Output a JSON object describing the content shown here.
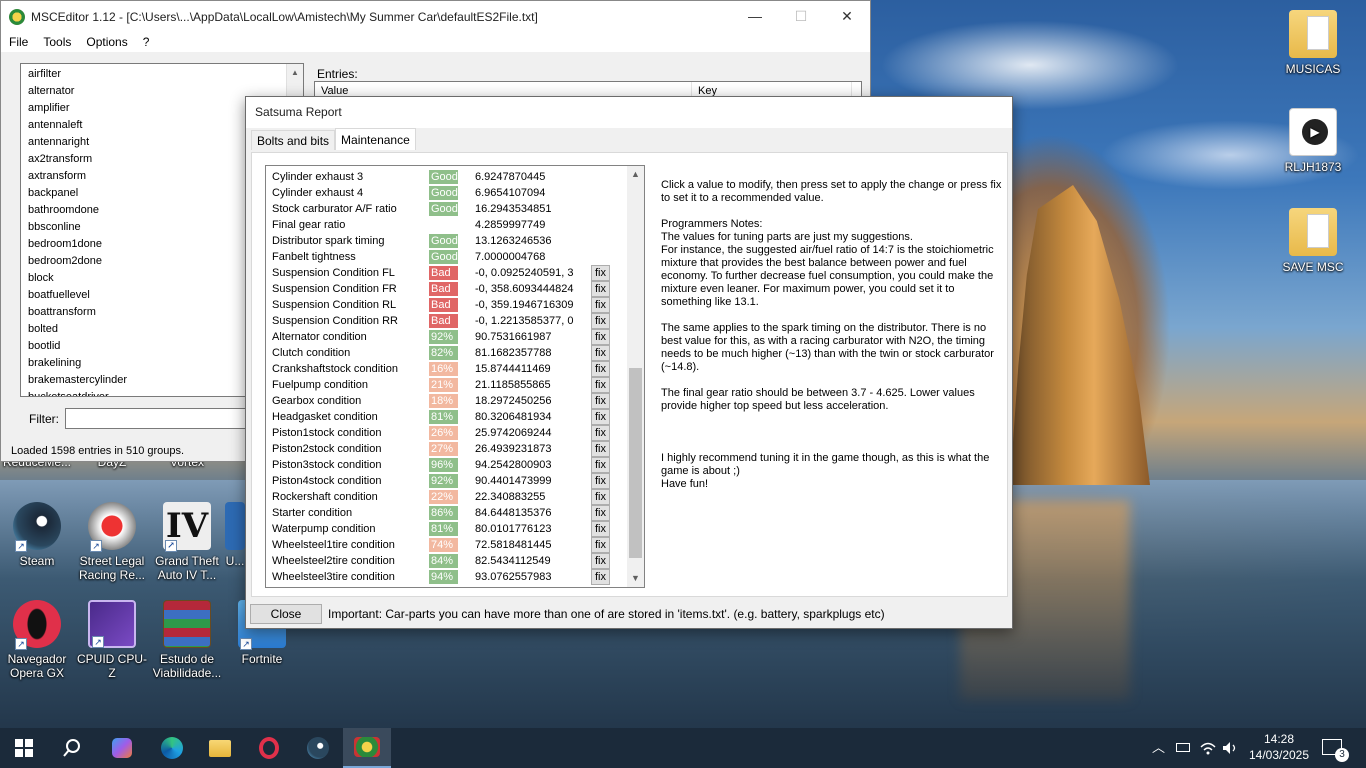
{
  "desktop": {
    "icons_right": [
      {
        "label": "MUSICAS"
      },
      {
        "label": "RLJH1873"
      },
      {
        "label": "SAVE MSC"
      }
    ],
    "icons_left_row1_partial": [
      "ReduceMe...",
      "DayZ",
      "Vortex"
    ],
    "icons_left_row2": [
      {
        "label": "Steam"
      },
      {
        "label": "Street Legal Racing Re..."
      },
      {
        "label": "Grand Theft Auto IV T..."
      },
      {
        "label": "U..."
      }
    ],
    "icons_left_row3": [
      {
        "label": "Navegador Opera GX"
      },
      {
        "label": "CPUID CPU-Z"
      },
      {
        "label": "Estudo de Viabilidade..."
      },
      {
        "label": "Fortnite"
      }
    ]
  },
  "editor": {
    "title": "MSCEditor 1.12 - [C:\\Users\\...\\AppData\\LocalLow\\Amistech\\My Summer Car\\defaultES2File.txt]",
    "menu": [
      "File",
      "Tools",
      "Options",
      "?"
    ],
    "groups": [
      "airfilter",
      "alternator",
      "amplifier",
      "antennaleft",
      "antennaright",
      "ax2transform",
      "axtransform",
      "backpanel",
      "bathroomdone",
      "bbsconline",
      "bedroom1done",
      "bedroom2done",
      "block",
      "boatfuellevel",
      "boattransform",
      "bolted",
      "bootlid",
      "brakelining",
      "brakemastercylinder",
      "bucketseatdriver"
    ],
    "entries_label": "Entries:",
    "columns": [
      "Value",
      "Key"
    ],
    "filter_label": "Filter:",
    "status": "Loaded 1598 entries in 510 groups."
  },
  "report": {
    "title": "Satsuma Report",
    "tabs": [
      "Bolts and bits",
      "Maintenance"
    ],
    "active_tab": "Maintenance",
    "rows": [
      {
        "name": "Cylinder exhaust 3",
        "status": "Good",
        "kind": "good",
        "value": "6.9247870445",
        "fix": ""
      },
      {
        "name": "Cylinder exhaust 4",
        "status": "Good",
        "kind": "good",
        "value": "6.9654107094",
        "fix": ""
      },
      {
        "name": "Stock carburator A/F ratio",
        "status": "Good",
        "kind": "good",
        "value": "16.2943534851",
        "fix": ""
      },
      {
        "name": "Final gear ratio",
        "status": "",
        "kind": "none",
        "value": "4.2859997749",
        "fix": ""
      },
      {
        "name": "Distributor spark timing",
        "status": "Good",
        "kind": "good",
        "value": "13.1263246536",
        "fix": ""
      },
      {
        "name": "Fanbelt tightness",
        "status": "Good",
        "kind": "good",
        "value": "7.0000004768",
        "fix": ""
      },
      {
        "name": "Suspension Condition FL",
        "status": "Bad",
        "kind": "bad",
        "value": "-0, 0.0925240591, 3",
        "fix": "fix"
      },
      {
        "name": "Suspension Condition FR",
        "status": "Bad",
        "kind": "bad",
        "value": "-0, 358.6093444824",
        "fix": "fix"
      },
      {
        "name": "Suspension Condition RL",
        "status": "Bad",
        "kind": "bad",
        "value": "-0, 359.1946716309",
        "fix": "fix"
      },
      {
        "name": "Suspension Condition RR",
        "status": "Bad",
        "kind": "bad",
        "value": "-0, 1.2213585377, 0",
        "fix": "fix"
      },
      {
        "name": "Alternator condition",
        "status": "92%",
        "kind": "high",
        "value": "90.7531661987",
        "fix": "fix"
      },
      {
        "name": "Clutch condition",
        "status": "82%",
        "kind": "high",
        "value": "81.1682357788",
        "fix": "fix"
      },
      {
        "name": "Crankshaftstock condition",
        "status": "16%",
        "kind": "low",
        "value": "15.8744411469",
        "fix": "fix"
      },
      {
        "name": "Fuelpump condition",
        "status": "21%",
        "kind": "low",
        "value": "21.1185855865",
        "fix": "fix"
      },
      {
        "name": "Gearbox condition",
        "status": "18%",
        "kind": "low",
        "value": "18.2972450256",
        "fix": "fix"
      },
      {
        "name": "Headgasket condition",
        "status": "81%",
        "kind": "high",
        "value": "80.3206481934",
        "fix": "fix"
      },
      {
        "name": "Piston1stock condition",
        "status": "26%",
        "kind": "low",
        "value": "25.9742069244",
        "fix": "fix"
      },
      {
        "name": "Piston2stock condition",
        "status": "27%",
        "kind": "low",
        "value": "26.4939231873",
        "fix": "fix"
      },
      {
        "name": "Piston3stock condition",
        "status": "96%",
        "kind": "high",
        "value": "94.2542800903",
        "fix": "fix"
      },
      {
        "name": "Piston4stock condition",
        "status": "92%",
        "kind": "high",
        "value": "90.4401473999",
        "fix": "fix"
      },
      {
        "name": "Rockershaft condition",
        "status": "22%",
        "kind": "low",
        "value": "22.340883255",
        "fix": "fix"
      },
      {
        "name": "Starter condition",
        "status": "86%",
        "kind": "high",
        "value": "84.6448135376",
        "fix": "fix"
      },
      {
        "name": "Waterpump condition",
        "status": "81%",
        "kind": "high",
        "value": "80.0101776123",
        "fix": "fix"
      },
      {
        "name": "Wheelsteel1tire condition",
        "status": "74%",
        "kind": "mid",
        "value": "72.5818481445",
        "fix": "fix"
      },
      {
        "name": "Wheelsteel2tire condition",
        "status": "84%",
        "kind": "high",
        "value": "82.5434112549",
        "fix": "fix"
      },
      {
        "name": "Wheelsteel3tire condition",
        "status": "94%",
        "kind": "high",
        "value": "93.0762557983",
        "fix": "fix"
      }
    ],
    "notes": [
      "Click a value to modify, then press set to apply the change or press fix to set it to a recommended value.",
      "Programmers Notes:\nThe values for tuning parts are just my suggestions.\nFor instance, the suggested air/fuel ratio of 14:7 is the stoichiometric mixture that provides the best balance between power and fuel economy. To further decrease fuel consumption, you could make the mixture even leaner. For maximum power, you could set it to something like 13.1.",
      "The same applies to the spark timing on the distributor. There is no best value for this, as with a racing carburator with N2O, the timing needs to be much higher (~13) than with the twin or stock carburator (~14.8).",
      "The final gear ratio should be between 3.7 - 4.625. Lower values provide higher top speed but less acceleration.",
      "",
      "I highly recommend tuning it in the game though, as this is what the game is about ;)\nHave fun!"
    ],
    "close_label": "Close",
    "important": "Important: Car-parts you can have more than one of are stored in 'items.txt'. (e.g. battery, sparkplugs etc)"
  },
  "taskbar": {
    "time": "14:28",
    "date": "14/03/2025",
    "notification_count": "3"
  },
  "colors": {
    "good": "#8fbf8a",
    "bad": "#e06666",
    "high": "#8fbf8a",
    "mid": "#f2b8a0",
    "low": "#f2b8a0"
  }
}
